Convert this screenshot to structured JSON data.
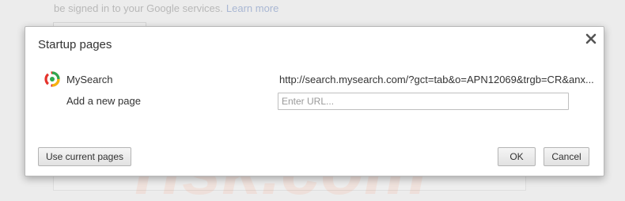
{
  "background": {
    "text": "be signed in to your Google services.",
    "link": "Learn more"
  },
  "dialog": {
    "title": "Startup pages",
    "close_icon": "close-icon",
    "pages": [
      {
        "name": "MySearch",
        "url": "http://search.mysearch.com/?gct=tab&o=APN12069&trgb=CR&anx..."
      }
    ],
    "add_label": "Add a new page",
    "url_placeholder": "Enter URL...",
    "buttons": {
      "use_current": "Use current pages",
      "ok": "OK",
      "cancel": "Cancel"
    }
  },
  "colors": {
    "dialog_bg": "#ffffff",
    "button_border": "#b4b4b4",
    "text": "#333333",
    "watermark": "#ff7a45"
  }
}
